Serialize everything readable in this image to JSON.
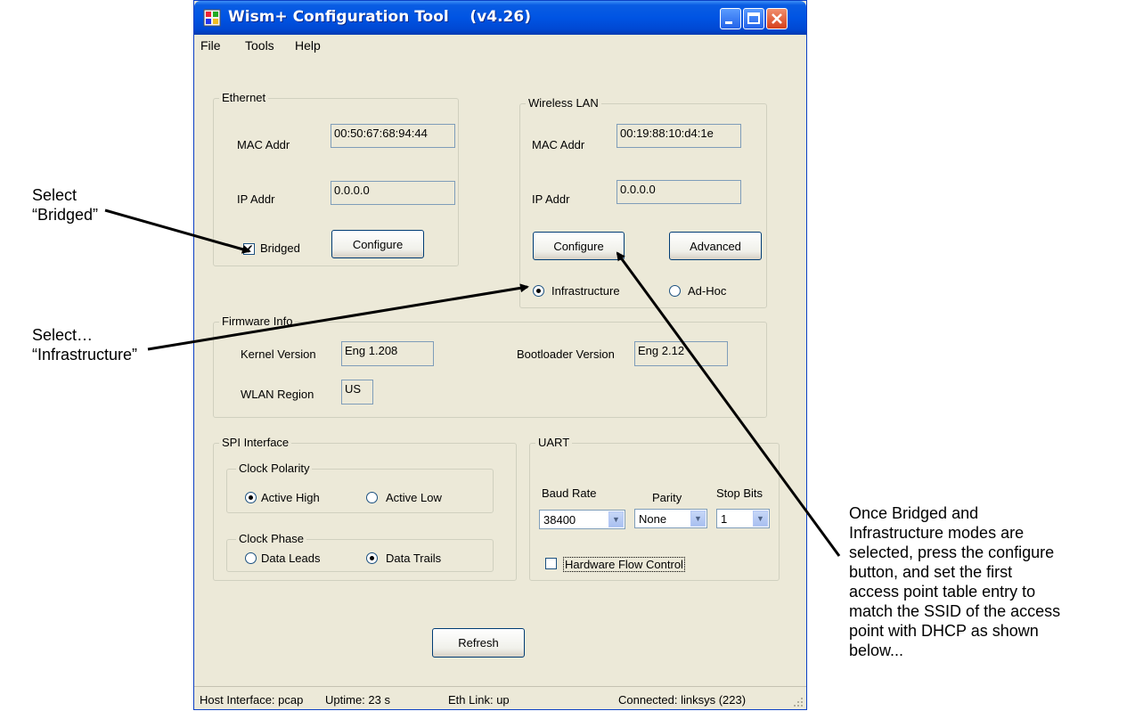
{
  "window": {
    "title": "Wism+ Configuration Tool    (v4.26)",
    "menu": [
      "File",
      "Tools",
      "Help"
    ]
  },
  "ethernet": {
    "legend": "Ethernet",
    "mac_label": "MAC Addr",
    "mac_value": "00:50:67:68:94:44",
    "ip_label": "IP Addr",
    "ip_value": "0.0.0.0",
    "bridged_label": "Bridged",
    "bridged_checked": true,
    "configure_label": "Configure"
  },
  "wlan": {
    "legend": "Wireless LAN",
    "mac_label": "MAC Addr",
    "mac_value": "00:19:88:10:d4:1e",
    "ip_label": "IP Addr",
    "ip_value": "0.0.0.0",
    "configure_label": "Configure",
    "advanced_label": "Advanced",
    "infrastructure_label": "Infrastructure",
    "adhoc_label": "Ad-Hoc",
    "mode_selected": "Infrastructure"
  },
  "firmware": {
    "legend": "Firmware Info",
    "kernel_label": "Kernel Version",
    "kernel_value": "Eng 1.208",
    "bootloader_label": "Bootloader Version",
    "bootloader_value": "Eng 2.12",
    "region_label": "WLAN Region",
    "region_value": "US"
  },
  "spi": {
    "legend": "SPI Interface",
    "polarity_legend": "Clock Polarity",
    "active_high": "Active High",
    "active_low": "Active Low",
    "phase_legend": "Clock Phase",
    "data_leads": "Data Leads",
    "data_trails": "Data Trails"
  },
  "uart": {
    "legend": "UART",
    "baud_label": "Baud Rate",
    "baud_value": "38400",
    "parity_label": "Parity",
    "parity_value": "None",
    "stopbits_label": "Stop Bits",
    "stopbits_value": "1",
    "flow_label": "Hardware Flow Control",
    "flow_checked": false
  },
  "refresh_label": "Refresh",
  "status": {
    "host": "Host Interface: pcap",
    "uptime": "Uptime: 23 s",
    "eth_link": "Eth Link: up",
    "connected": "Connected: linksys (223)"
  },
  "annotations": {
    "bridged_line1": "Select",
    "bridged_line2": "“Bridged”",
    "infra_line1": "Select…",
    "infra_line2": "“Infrastructure”",
    "configure_lines": [
      "Once Bridged and",
      "Infrastructure modes are",
      "selected, press the configure",
      "button, and set the first",
      "access point table entry to",
      "match the SSID of the access",
      "point with DHCP as shown",
      "below..."
    ]
  }
}
